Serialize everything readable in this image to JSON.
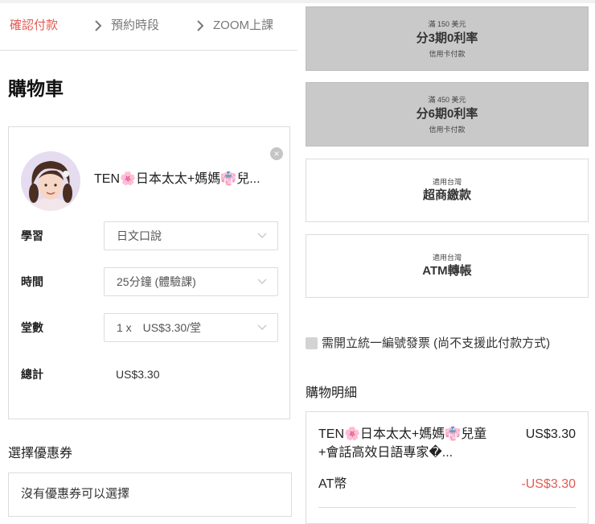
{
  "steps": [
    {
      "label": "確認付款",
      "active": true
    },
    {
      "label": "預約時段",
      "active": false
    },
    {
      "label": "ZOOM上課",
      "active": false
    }
  ],
  "cart": {
    "title": "購物車",
    "item_name": "TEN🌸日本太太+媽媽👘兒...",
    "fields": {
      "study_label": "學習",
      "study_value": "日文口說",
      "time_label": "時間",
      "time_value": "25分鐘 (體驗課)",
      "count_label": "堂數",
      "count_value": "1 x　US$3.30/堂",
      "total_label": "總計",
      "total_value": "US$3.30"
    },
    "close_symbol": "×"
  },
  "coupon": {
    "title": "選擇優惠券",
    "empty_text": "沒有優惠券可以選擇"
  },
  "payment_options": [
    {
      "small_top": "滿 150 美元",
      "main": "分3期0利率",
      "small_bottom": "信用卡付款"
    },
    {
      "small_top": "滿 450 美元",
      "main": "分6期0利率",
      "small_bottom": "信用卡付款"
    },
    {
      "small_top": "適用台灣",
      "main": "超商繳款"
    },
    {
      "small_top": "適用台灣",
      "main": "ATM轉帳"
    }
  ],
  "invoice": {
    "label": "需開立統一編號發票 (尚不支援此付款方式)"
  },
  "details": {
    "title": "購物明細",
    "item_name": "TEN🌸日本太太+媽媽👘兒童+會話高效日語專家�...",
    "item_price": "US$3.30",
    "at_label": "AT幣",
    "at_value": "-US$3.30"
  },
  "colors": {
    "accent": "#e25b52",
    "disabled_option": "#c9c9c9",
    "border": "#dcdcdc"
  },
  "icons": {
    "step_separator": "chevron-right-icon",
    "select_arrow": "chevron-down-icon",
    "remove": "close-icon"
  }
}
